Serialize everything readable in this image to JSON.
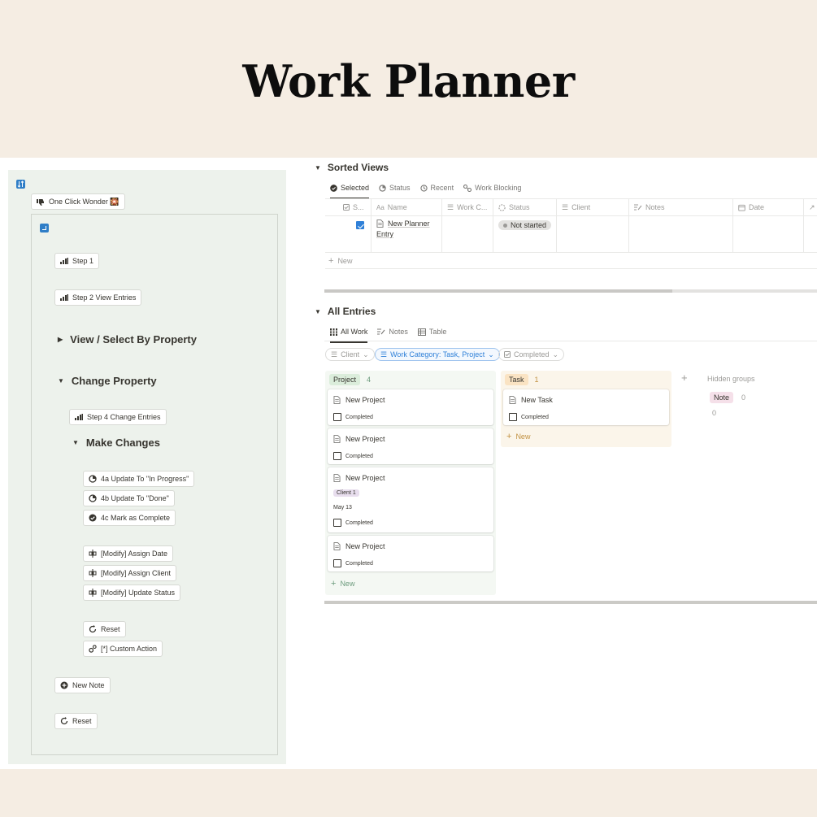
{
  "hero": {
    "title": "Work Planner"
  },
  "left": {
    "one_click": "One Click Wonder 🎇",
    "step1": "Step 1",
    "step2": "Step 2 View Entries",
    "view_select": "View / Select By Property",
    "change_property": "Change Property",
    "step4": "Step 4 Change Entries",
    "make_changes": "Make Changes",
    "btn_4a": "4a Update To \"In Progress\"",
    "btn_4b": "4b Update To \"Done\"",
    "btn_4c": "4c Mark as Complete",
    "assign_date": "[Modify] Assign Date",
    "assign_client": "[Modify] Assign Client",
    "update_status": "[Modify] Update Status",
    "reset": "Reset",
    "custom_action": "[*] Custom Action",
    "new_note": "New Note",
    "reset2": "Reset"
  },
  "sorted": {
    "title": "Sorted Views",
    "tabs": [
      "Selected",
      "Status",
      "Recent",
      "Work Blocking"
    ],
    "columns": [
      "S...",
      "Name",
      "Work C...",
      "Status",
      "Client",
      "Notes",
      "Date"
    ],
    "row": {
      "selected": true,
      "name_line1": "New Planner",
      "name_line2": "Entry",
      "status": "Not started"
    },
    "new_label": "New"
  },
  "all": {
    "title": "All Entries",
    "tabs": [
      "All Work",
      "Notes",
      "Table"
    ],
    "filters": {
      "client": "Client",
      "category": "Work Category: Task, Project",
      "completed": "Completed"
    },
    "project": {
      "label": "Project",
      "count": "4",
      "cards": [
        {
          "title": "New Project",
          "completed": "Completed"
        },
        {
          "title": "New Project",
          "completed": "Completed"
        },
        {
          "title": "New Project",
          "client": "Client 1",
          "date": "May 13",
          "completed": "Completed"
        },
        {
          "title": "New Project",
          "completed": "Completed"
        }
      ],
      "new_label": "New"
    },
    "task": {
      "label": "Task",
      "count": "1",
      "cards": [
        {
          "title": "New Task",
          "completed": "Completed"
        }
      ],
      "new_label": "New"
    },
    "hidden": {
      "label": "Hidden groups",
      "note_label": "Note",
      "note_count": "0",
      "extra_count": "0"
    }
  },
  "colors": {
    "background": "#f5ede3",
    "panel": "#edf2ec",
    "project_tag": "#dbeddb",
    "project_col": "#f4f8f3",
    "task_tag": "#fae3c3",
    "task_col": "#fbf5ea",
    "note_tag": "#f5e0e9",
    "client_tag": "#e8deee",
    "accent_blue": "#2f80d8"
  }
}
